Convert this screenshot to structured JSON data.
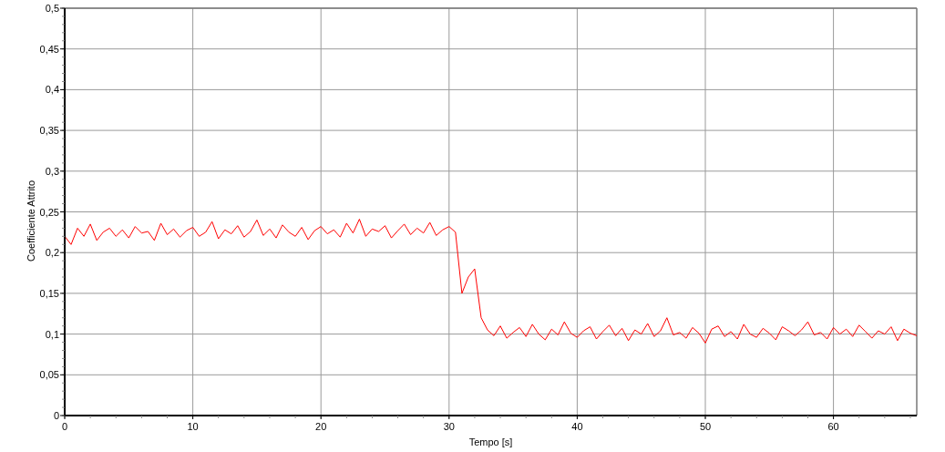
{
  "chart_data": {
    "type": "line",
    "grid": true,
    "xlabel": "Tempo [s]",
    "ylabel": "Coefficiente Attrito",
    "xlim": [
      0,
      66.5
    ],
    "ylim": [
      0,
      0.5
    ],
    "xticks": [
      0,
      10,
      20,
      30,
      40,
      50,
      60
    ],
    "yticks": [
      {
        "value": 0,
        "label": "0"
      },
      {
        "value": 0.05,
        "label": "0,05"
      },
      {
        "value": 0.1,
        "label": "0,1"
      },
      {
        "value": 0.15,
        "label": "0,15"
      },
      {
        "value": 0.2,
        "label": "0,2"
      },
      {
        "value": 0.25,
        "label": "0,25"
      },
      {
        "value": 0.3,
        "label": "0,3"
      },
      {
        "value": 0.35,
        "label": "0,35"
      },
      {
        "value": 0.4,
        "label": "0,4"
      },
      {
        "value": 0.45,
        "label": "0,45"
      },
      {
        "value": 0.5,
        "label": "0,5"
      }
    ],
    "x": [
      0,
      0.5,
      1,
      1.5,
      2,
      2.5,
      3,
      3.5,
      4,
      4.5,
      5,
      5.5,
      6,
      6.5,
      7,
      7.5,
      8,
      8.5,
      9,
      9.5,
      10,
      10.5,
      11,
      11.5,
      12,
      12.5,
      13,
      13.5,
      14,
      14.5,
      15,
      15.5,
      16,
      16.5,
      17,
      17.5,
      18,
      18.5,
      19,
      19.5,
      20,
      20.5,
      21,
      21.5,
      22,
      22.5,
      23,
      23.5,
      24,
      24.5,
      25,
      25.5,
      26,
      26.5,
      27,
      27.5,
      28,
      28.5,
      29,
      29.5,
      30,
      30.5,
      31,
      31.5,
      32,
      32.5,
      33,
      33.5,
      34,
      34.5,
      35,
      35.5,
      36,
      36.5,
      37,
      37.5,
      38,
      38.5,
      39,
      39.5,
      40,
      40.5,
      41,
      41.5,
      42,
      42.5,
      43,
      43.5,
      44,
      44.5,
      45,
      45.5,
      46,
      46.5,
      47,
      47.5,
      48,
      48.5,
      49,
      49.5,
      50,
      50.5,
      51,
      51.5,
      52,
      52.5,
      53,
      53.5,
      54,
      54.5,
      55,
      55.5,
      56,
      56.5,
      57,
      57.5,
      58,
      58.5,
      59,
      59.5,
      60,
      60.5,
      61,
      61.5,
      62,
      62.5,
      63,
      63.5,
      64,
      64.5,
      65,
      65.5,
      66,
      66.5
    ],
    "series": [
      {
        "color": "#ff0000",
        "values": [
          0.22,
          0.21,
          0.23,
          0.22,
          0.235,
          0.215,
          0.225,
          0.23,
          0.22,
          0.228,
          0.218,
          0.232,
          0.224,
          0.226,
          0.215,
          0.236,
          0.222,
          0.229,
          0.219,
          0.227,
          0.231,
          0.22,
          0.225,
          0.238,
          0.217,
          0.228,
          0.223,
          0.233,
          0.219,
          0.226,
          0.24,
          0.221,
          0.229,
          0.218,
          0.234,
          0.225,
          0.22,
          0.231,
          0.216,
          0.227,
          0.232,
          0.223,
          0.228,
          0.219,
          0.236,
          0.224,
          0.241,
          0.22,
          0.229,
          0.226,
          0.233,
          0.218,
          0.227,
          0.235,
          0.222,
          0.23,
          0.224,
          0.237,
          0.221,
          0.228,
          0.232,
          0.225,
          0.15,
          0.17,
          0.18,
          0.12,
          0.105,
          0.098,
          0.11,
          0.095,
          0.102,
          0.108,
          0.097,
          0.112,
          0.1,
          0.093,
          0.106,
          0.099,
          0.115,
          0.101,
          0.096,
          0.104,
          0.109,
          0.094,
          0.103,
          0.111,
          0.098,
          0.107,
          0.092,
          0.105,
          0.1,
          0.113,
          0.097,
          0.104,
          0.12,
          0.099,
          0.102,
          0.095,
          0.108,
          0.101,
          0.089,
          0.106,
          0.11,
          0.097,
          0.103,
          0.094,
          0.112,
          0.1,
          0.096,
          0.107,
          0.101,
          0.093,
          0.109,
          0.104,
          0.098,
          0.105,
          0.115,
          0.099,
          0.102,
          0.094,
          0.108,
          0.1,
          0.106,
          0.097,
          0.111,
          0.103,
          0.095,
          0.104,
          0.1,
          0.109,
          0.092,
          0.106,
          0.101,
          0.098
        ]
      }
    ]
  }
}
